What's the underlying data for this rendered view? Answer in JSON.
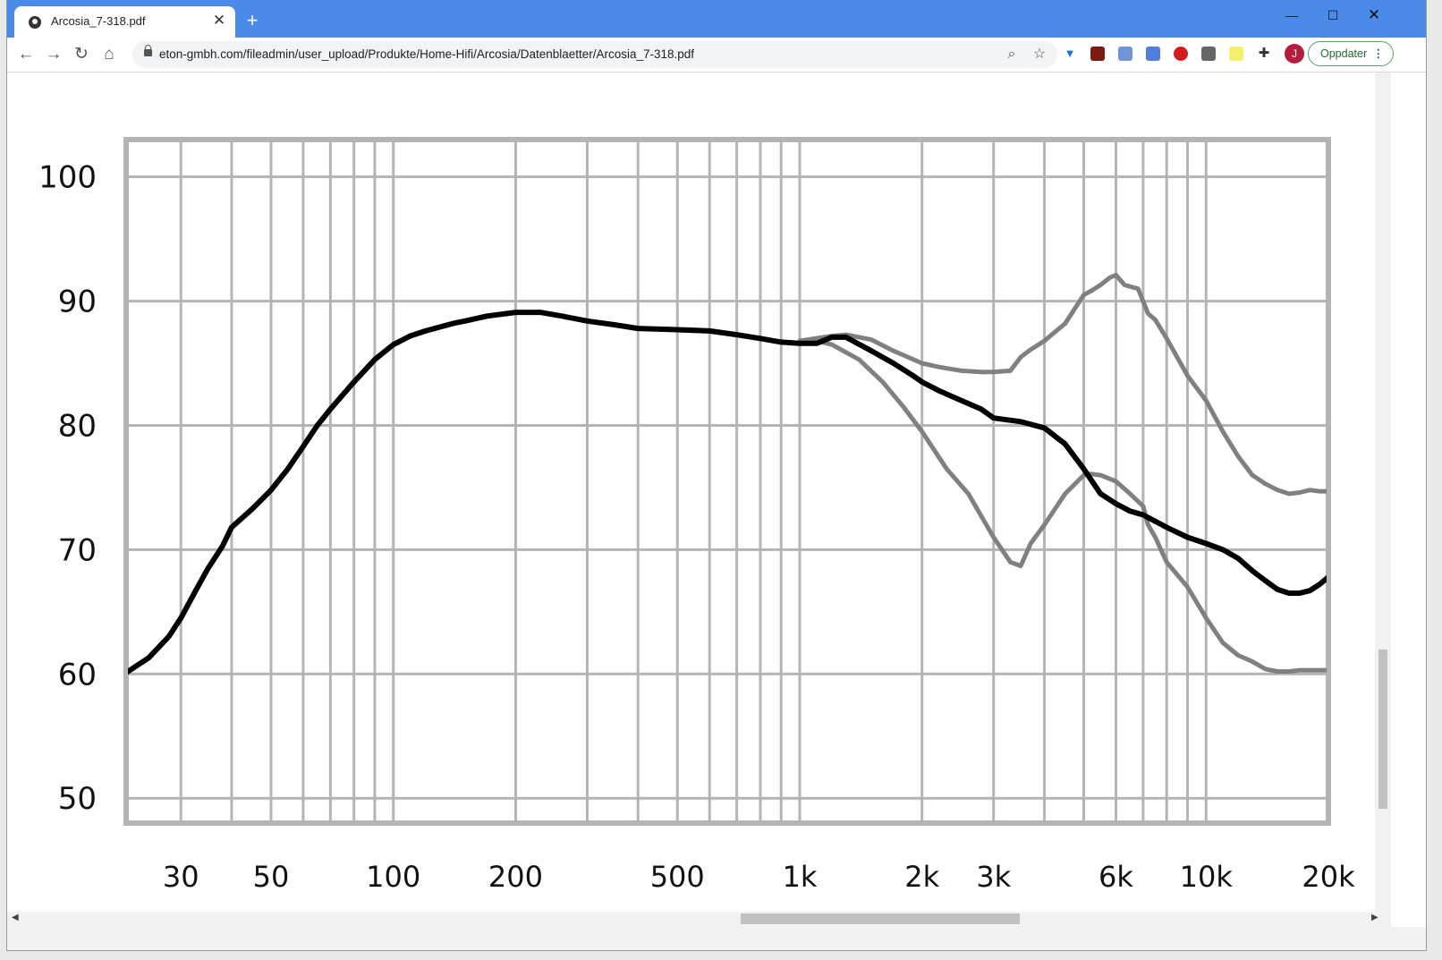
{
  "browser": {
    "tab_title": "Arcosia_7-318.pdf",
    "tab_close_icon": "close-icon",
    "new_tab_icon": "plus-icon",
    "url": "eton-gmbh.com/fileadmin/user_upload/Produkte/Home-Hifi/Arcosia/Datenblaetter/Arcosia_7-318.pdf",
    "avatar_initial": "J",
    "update_label": "Oppdater",
    "accent_color": "#4a8be9"
  },
  "chart_data": {
    "type": "line",
    "title": "",
    "xlabel": "",
    "ylabel": "",
    "x_scale": "log",
    "xlim": [
      22,
      20000
    ],
    "ylim": [
      48,
      103
    ],
    "grid": true,
    "y_ticks": [
      100,
      90,
      80,
      70,
      60,
      50
    ],
    "x_tick_labels": [
      {
        "x": 30,
        "label": "30"
      },
      {
        "x": 50,
        "label": "50"
      },
      {
        "x": 100,
        "label": "100"
      },
      {
        "x": 200,
        "label": "200"
      },
      {
        "x": 500,
        "label": "500"
      },
      {
        "x": 1000,
        "label": "1k"
      },
      {
        "x": 2000,
        "label": "2k"
      },
      {
        "x": 3000,
        "label": "3k"
      },
      {
        "x": 6000,
        "label": "6k"
      },
      {
        "x": 10000,
        "label": "10k"
      },
      {
        "x": 20000,
        "label": "20k"
      }
    ],
    "series": [
      {
        "color": "#000000",
        "x": [
          20,
          22,
          25,
          28,
          30,
          33,
          35,
          38,
          40,
          45,
          50,
          55,
          60,
          65,
          70,
          80,
          90,
          100,
          110,
          120,
          140,
          150,
          170,
          200,
          230,
          260,
          300,
          350,
          400,
          500,
          600,
          700,
          800,
          900,
          1000,
          1100,
          1200,
          1300,
          1500,
          1700,
          1900,
          2000,
          2200,
          2500,
          2800,
          3000,
          3500,
          4000,
          4500,
          5000,
          5500,
          6000,
          6500,
          7000,
          8000,
          9000,
          10000,
          11000,
          12000,
          13000,
          14000,
          15000,
          16000,
          17000,
          18000,
          19000,
          20000
        ],
        "y": [
          60,
          60.1,
          61.3,
          63,
          64.5,
          67,
          68.5,
          70.3,
          71.8,
          73.3,
          74.8,
          76.5,
          78.3,
          80,
          81.3,
          83.5,
          85.3,
          86.5,
          87.2,
          87.6,
          88.2,
          88.4,
          88.8,
          89.1,
          89.1,
          88.8,
          88.4,
          88.1,
          87.8,
          87.7,
          87.6,
          87.3,
          87.0,
          86.7,
          86.6,
          86.6,
          87.1,
          87.1,
          86.0,
          85.0,
          84.0,
          83.5,
          82.8,
          82.0,
          81.3,
          80.6,
          80.3,
          79.8,
          78.5,
          76.5,
          74.5,
          73.7,
          73.1,
          72.8,
          71.8,
          71.0,
          70.5,
          70.0,
          69.3,
          68.3,
          67.5,
          66.8,
          66.5,
          66.5,
          66.7,
          67.2,
          67.8
        ]
      },
      {
        "color": "#808080",
        "x": [
          1000,
          1200,
          1300,
          1500,
          1700,
          2000,
          2200,
          2500,
          2800,
          3000,
          3300,
          3500,
          3700,
          4000,
          4500,
          5000,
          5200,
          5500,
          5800,
          6000,
          6300,
          6800,
          7200,
          7500,
          8000,
          9000,
          10000,
          11000,
          12000,
          13000,
          14000,
          15000,
          16000,
          17000,
          18000,
          19000,
          20000
        ],
        "y": [
          86.8,
          87.2,
          87.3,
          86.9,
          86.0,
          85.0,
          84.7,
          84.4,
          84.3,
          84.3,
          84.4,
          85.5,
          86.1,
          86.8,
          88.2,
          90.5,
          90.8,
          91.3,
          91.9,
          92.1,
          91.3,
          91.0,
          89.0,
          88.5,
          87.0,
          84.0,
          82.0,
          79.5,
          77.5,
          76.0,
          75.3,
          74.8,
          74.5,
          74.6,
          74.8,
          74.7,
          74.7
        ]
      },
      {
        "color": "#808080",
        "x": [
          1000,
          1100,
          1200,
          1400,
          1600,
          1800,
          2000,
          2300,
          2600,
          3000,
          3300,
          3500,
          3700,
          4000,
          4500,
          5000,
          5200,
          5500,
          6000,
          6500,
          7000,
          7200,
          7500,
          8000,
          9000,
          10000,
          11000,
          12000,
          13000,
          14000,
          15000,
          16000,
          17000,
          18000,
          19000,
          20000
        ],
        "y": [
          86.8,
          86.8,
          86.5,
          85.3,
          83.5,
          81.5,
          79.5,
          76.5,
          74.5,
          71.0,
          69.0,
          68.7,
          70.5,
          72.0,
          74.5,
          76.0,
          76.1,
          76.0,
          75.5,
          74.5,
          73.5,
          72.0,
          71.0,
          69.0,
          67.0,
          64.5,
          62.5,
          61.5,
          61.0,
          60.4,
          60.2,
          60.2,
          60.3,
          60.3,
          60.3,
          60.3
        ]
      }
    ]
  }
}
